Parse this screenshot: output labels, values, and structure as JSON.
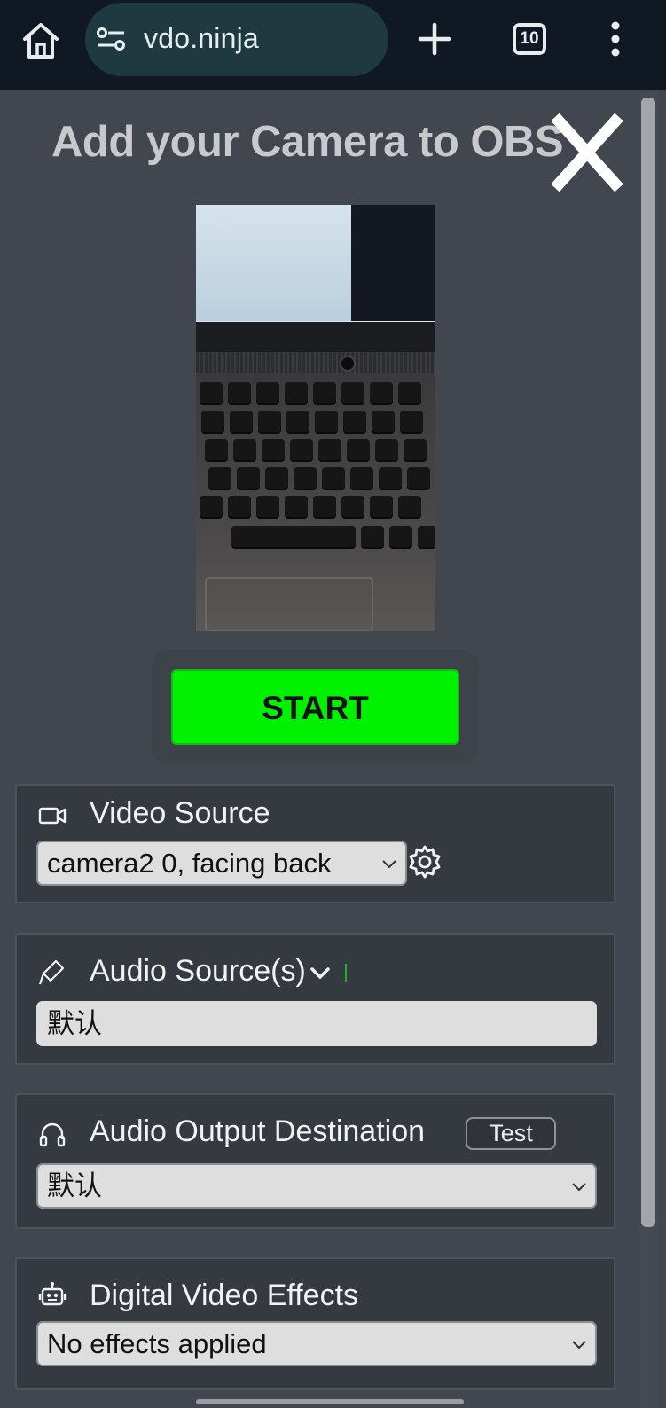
{
  "browser": {
    "url": "vdo.ninja",
    "tab_count": "10"
  },
  "page": {
    "title": "Add your Camera to OBS",
    "start_label": "START"
  },
  "video_source": {
    "label": "Video Source",
    "selected": "camera2 0, facing back"
  },
  "audio_source": {
    "label": "Audio Source(s)",
    "selected": "默认"
  },
  "audio_output": {
    "label": "Audio Output Destination",
    "test_label": "Test",
    "selected": "默认"
  },
  "effects": {
    "label": "Digital Video Effects",
    "selected": "No effects applied"
  },
  "colors": {
    "start_button": "#00f200",
    "background": "#41464f",
    "panel": "#353940",
    "browser_bar": "#101923"
  }
}
